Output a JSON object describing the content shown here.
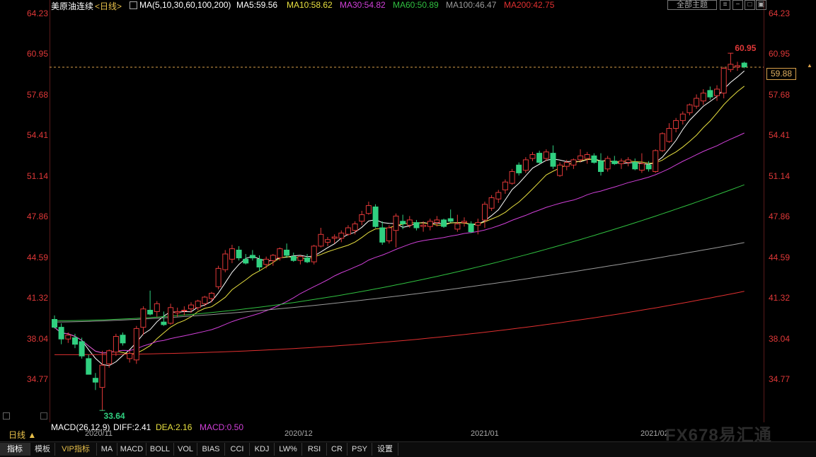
{
  "header": {
    "symbol": "美原油连续",
    "period_link": "<日线>",
    "ma_params": "MA(5,10,30,60,100,200)",
    "ma5": "MA5:59.56",
    "ma10": "MA10:58.62",
    "ma30": "MA30:54.82",
    "ma60": "MA60:50.89",
    "ma100": "MA100:46.47",
    "ma200": "MA200:42.75",
    "theme_button": "全部主题",
    "colors": {
      "ma5": "#ffffff",
      "ma10": "#e8e040",
      "ma30": "#d040d8",
      "ma60": "#30c040",
      "ma100": "#9a9a9a",
      "ma200": "#e03030"
    }
  },
  "price_axis": {
    "left_labels": [
      "64.23",
      "60.95",
      "57.68",
      "54.41",
      "51.14",
      "47.86",
      "44.59",
      "41.32",
      "38.04",
      "34.77"
    ],
    "right_labels": [
      "64.23",
      "60.95",
      "57.68",
      "54.41",
      "51.14",
      "47.86",
      "44.59",
      "41.32",
      "38.04",
      "34.77"
    ]
  },
  "current_price": "59.88",
  "annotations": {
    "high": "60.95",
    "low": "33.64"
  },
  "macd": {
    "label": "MACD(26,12,9)",
    "diff": "DIFF:2.41",
    "dea": "DEA:2.16",
    "macd": "MACD:0.50"
  },
  "period_label": "日线 ▲",
  "x_axis": [
    "2020/11",
    "2020/12",
    "2021/01",
    "2021/02"
  ],
  "tabs": [
    "指标",
    "模板",
    "VIP指标",
    "MA",
    "MACD",
    "BOLL",
    "VOL",
    "BIAS",
    "CCI",
    "KDJ",
    "LW%",
    "RSI",
    "CR",
    "PSY",
    "设置"
  ],
  "watermark": "FX678易汇通",
  "chart_data": {
    "type": "candlestick",
    "ylim": [
      33.0,
      64.8
    ],
    "up_color": "#e03838",
    "down_color": "#30d080",
    "candles": [
      [
        40.6,
        40.9,
        39.9,
        40.0
      ],
      [
        40.0,
        40.3,
        38.7,
        39.1
      ],
      [
        39.1,
        39.6,
        38.8,
        39.4
      ],
      [
        39.2,
        39.5,
        38.4,
        38.7
      ],
      [
        38.9,
        39.2,
        37.6,
        37.8
      ],
      [
        37.6,
        37.9,
        36.6,
        36.4
      ],
      [
        36.1,
        36.5,
        35.2,
        35.8
      ],
      [
        35.4,
        38.2,
        33.6,
        37.1
      ],
      [
        37.2,
        38.3,
        36.9,
        38.2
      ],
      [
        38.1,
        39.5,
        37.8,
        39.3
      ],
      [
        39.4,
        39.6,
        38.6,
        38.8
      ],
      [
        37.6,
        38.2,
        37.3,
        38.0
      ],
      [
        37.5,
        40.1,
        37.2,
        39.9
      ],
      [
        40.0,
        41.6,
        39.4,
        41.4
      ],
      [
        41.3,
        42.8,
        40.9,
        41.0
      ],
      [
        41.2,
        42.0,
        40.8,
        41.8
      ],
      [
        40.4,
        41.2,
        40.1,
        40.2
      ],
      [
        40.3,
        41.8,
        40.2,
        41.5
      ],
      [
        41.1,
        41.5,
        40.8,
        41.2
      ],
      [
        41.3,
        41.6,
        40.9,
        41.3
      ],
      [
        41.4,
        41.9,
        41.1,
        41.7
      ],
      [
        41.5,
        42.1,
        41.3,
        42.0
      ],
      [
        41.8,
        42.4,
        41.6,
        42.3
      ],
      [
        42.2,
        42.7,
        41.9,
        42.6
      ],
      [
        43.1,
        44.7,
        42.9,
        44.5
      ],
      [
        44.4,
        45.9,
        44.2,
        45.6
      ],
      [
        45.2,
        46.3,
        44.9,
        46.0
      ],
      [
        45.9,
        46.2,
        45.1,
        45.3
      ],
      [
        45.2,
        45.6,
        44.8,
        44.9
      ],
      [
        45.5,
        45.9,
        45.1,
        45.3
      ],
      [
        45.2,
        45.5,
        44.3,
        44.6
      ],
      [
        44.8,
        45.4,
        44.5,
        45.2
      ],
      [
        45.1,
        45.6,
        44.7,
        45.5
      ],
      [
        45.3,
        46.1,
        45.1,
        46.0
      ],
      [
        45.9,
        46.4,
        45.3,
        45.5
      ],
      [
        45.4,
        45.7,
        45.0,
        45.1
      ],
      [
        45.1,
        45.5,
        44.8,
        45.4
      ],
      [
        45.3,
        45.6,
        44.9,
        45.0
      ],
      [
        45.0,
        46.3,
        44.8,
        46.2
      ],
      [
        46.2,
        47.6,
        46.1,
        47.1
      ],
      [
        46.5,
        46.9,
        46.2,
        46.7
      ],
      [
        46.8,
        47.1,
        46.4,
        46.9
      ],
      [
        46.8,
        47.4,
        46.5,
        47.2
      ],
      [
        47.1,
        47.8,
        47.0,
        47.6
      ],
      [
        47.4,
        48.1,
        47.1,
        47.9
      ],
      [
        48.1,
        48.9,
        47.8,
        48.6
      ],
      [
        48.7,
        49.6,
        48.6,
        49.3
      ],
      [
        49.2,
        49.4,
        47.6,
        47.7
      ],
      [
        47.6,
        48.1,
        46.3,
        46.5
      ],
      [
        46.6,
        47.8,
        46.4,
        47.6
      ],
      [
        47.4,
        48.7,
        46.1,
        48.5
      ],
      [
        48.1,
        48.6,
        47.5,
        47.9
      ],
      [
        47.8,
        48.5,
        47.6,
        48.2
      ],
      [
        48.0,
        48.2,
        47.4,
        47.6
      ],
      [
        47.7,
        48.1,
        47.3,
        47.8
      ],
      [
        47.7,
        48.3,
        47.4,
        48.1
      ],
      [
        48.0,
        48.5,
        47.7,
        48.2
      ],
      [
        48.2,
        48.3,
        47.6,
        47.7
      ],
      [
        48.3,
        49.0,
        48.0,
        48.1
      ],
      [
        47.5,
        48.6,
        47.3,
        47.9
      ],
      [
        48.0,
        48.4,
        47.7,
        48.1
      ],
      [
        47.9,
        48.1,
        47.2,
        47.3
      ],
      [
        47.8,
        48.3,
        47.1,
        48.0
      ],
      [
        48.2,
        49.6,
        47.6,
        49.4
      ],
      [
        49.1,
        50.1,
        48.9,
        49.9
      ],
      [
        49.8,
        50.5,
        49.5,
        50.3
      ],
      [
        50.5,
        51.3,
        50.2,
        51.1
      ],
      [
        51.0,
        52.1,
        50.9,
        51.9
      ],
      [
        52.4,
        52.6,
        51.6,
        51.8
      ],
      [
        52.0,
        53.0,
        51.8,
        52.8
      ],
      [
        52.9,
        53.4,
        52.7,
        53.2
      ],
      [
        53.3,
        53.5,
        52.5,
        52.6
      ],
      [
        52.9,
        53.6,
        52.7,
        53.4
      ],
      [
        53.3,
        53.9,
        52.1,
        52.3
      ],
      [
        51.6,
        52.6,
        51.5,
        52.4
      ],
      [
        52.3,
        52.8,
        52.0,
        52.6
      ],
      [
        52.4,
        52.9,
        52.1,
        52.8
      ],
      [
        52.8,
        53.6,
        52.6,
        53.1
      ],
      [
        52.9,
        53.4,
        52.5,
        53.2
      ],
      [
        53.1,
        53.3,
        52.5,
        52.6
      ],
      [
        52.7,
        53.3,
        51.6,
        51.9
      ],
      [
        52.1,
        53.1,
        51.9,
        52.9
      ],
      [
        52.7,
        53.1,
        52.4,
        52.5
      ],
      [
        52.5,
        52.9,
        52.1,
        52.7
      ],
      [
        52.6,
        53.0,
        52.3,
        52.8
      ],
      [
        52.6,
        52.9,
        52.0,
        52.1
      ],
      [
        52.0,
        53.3,
        51.8,
        52.5
      ],
      [
        52.4,
        52.7,
        51.9,
        52.1
      ],
      [
        51.9,
        53.6,
        51.8,
        53.5
      ],
      [
        53.5,
        54.9,
        53.4,
        54.8
      ],
      [
        54.2,
        55.6,
        54.1,
        55.2
      ],
      [
        55.2,
        56.0,
        54.9,
        55.8
      ],
      [
        55.8,
        56.5,
        55.5,
        56.3
      ],
      [
        56.4,
        57.1,
        56.2,
        57.0
      ],
      [
        56.9,
        57.8,
        56.7,
        57.5
      ],
      [
        57.3,
        58.2,
        57.0,
        57.9
      ],
      [
        58.1,
        58.4,
        57.4,
        57.6
      ],
      [
        57.7,
        58.5,
        57.3,
        58.2
      ],
      [
        57.9,
        59.9,
        57.5,
        59.8
      ],
      [
        59.7,
        60.95,
        59.5,
        60.1
      ],
      [
        59.9,
        60.3,
        59.6,
        60.0
      ],
      [
        60.2,
        60.3,
        59.8,
        59.9
      ]
    ]
  }
}
